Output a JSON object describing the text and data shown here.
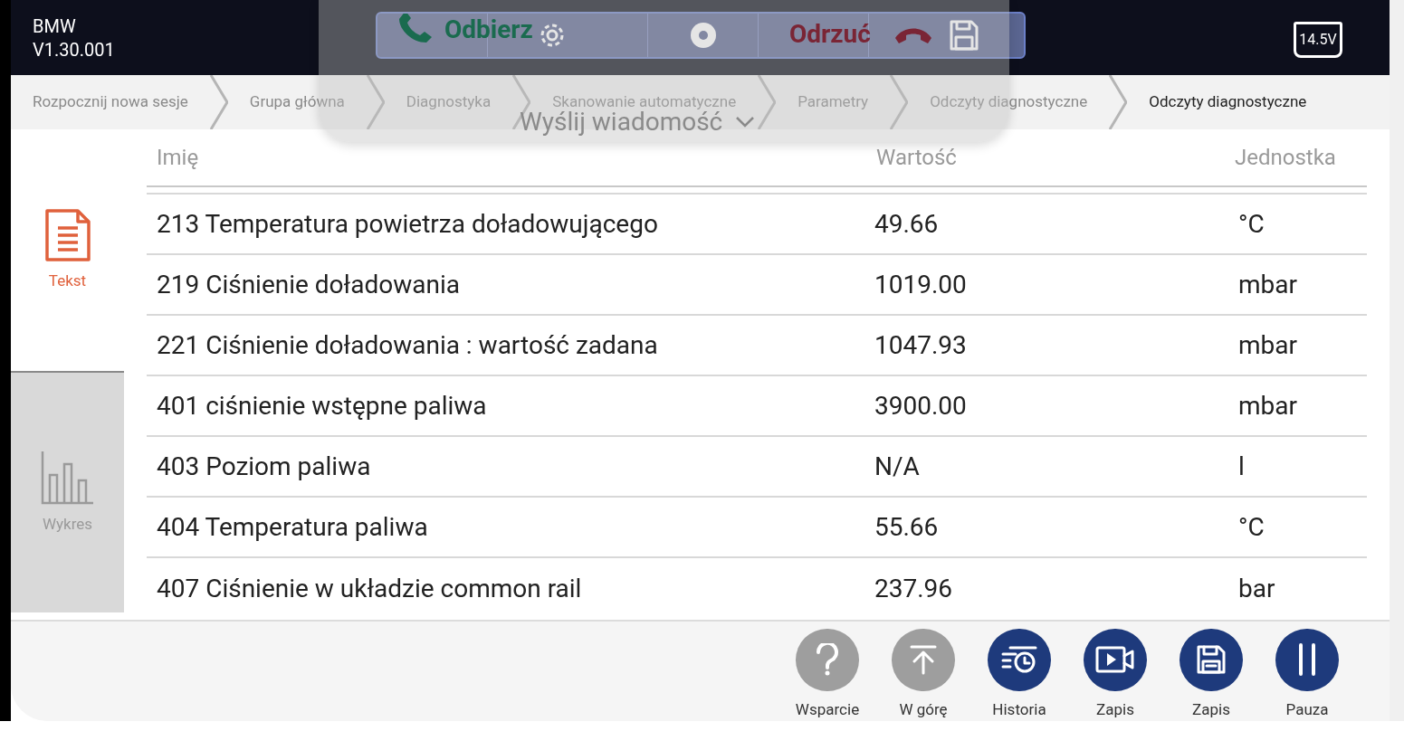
{
  "app": {
    "brand": "BMW",
    "version": "V1.30.001",
    "battery": "14.5V"
  },
  "call_overlay": {
    "accept": "Odbierz",
    "decline": "Odrzuć",
    "message": "Wyślij wiadomość"
  },
  "breadcrumbs": [
    {
      "label": "Rozpocznij nowa sesje",
      "selected": false
    },
    {
      "label": "Grupa główna",
      "selected": false
    },
    {
      "label": "Diagnostyka",
      "selected": false
    },
    {
      "label": "Skanowanie automatyczne",
      "selected": false
    },
    {
      "label": "Parametry",
      "selected": false
    },
    {
      "label": "Odczyty diagnostyczne",
      "selected": false
    },
    {
      "label": "Odczyty diagnostyczne",
      "selected": true
    }
  ],
  "sidebar": [
    {
      "kind": "text",
      "label": "Tekst",
      "selected": true
    },
    {
      "kind": "chart",
      "label": "Wykres",
      "selected": false
    }
  ],
  "table": {
    "columns": [
      "Imię",
      "Wartość",
      "Jednostka"
    ],
    "rows": [
      [
        "213 Temperatura powietrza doładowującego",
        "49.66",
        "°C"
      ],
      [
        "219 Ciśnienie doładowania",
        "1019.00",
        "mbar"
      ],
      [
        "221 Ciśnienie doładowania : wartość zadana",
        "1047.93",
        "mbar"
      ],
      [
        "401 ciśnienie wstępne paliwa",
        "3900.00",
        "mbar"
      ],
      [
        "403 Poziom paliwa",
        "N/A",
        "l"
      ],
      [
        "404 Temperatura paliwa",
        "55.66",
        "°C"
      ],
      [
        "407 Ciśnienie w układzie common rail",
        "237.96",
        "bar"
      ]
    ]
  },
  "actions": [
    {
      "kind": "help",
      "label": "Wsparcie",
      "disabled": true
    },
    {
      "kind": "top",
      "label": "W górę",
      "disabled": true
    },
    {
      "kind": "history",
      "label": "Historia",
      "disabled": false
    },
    {
      "kind": "record",
      "label": "Zapis",
      "disabled": false
    },
    {
      "kind": "save",
      "label": "Zapis",
      "disabled": false
    },
    {
      "kind": "pause",
      "label": "Pauza",
      "disabled": false
    }
  ]
}
